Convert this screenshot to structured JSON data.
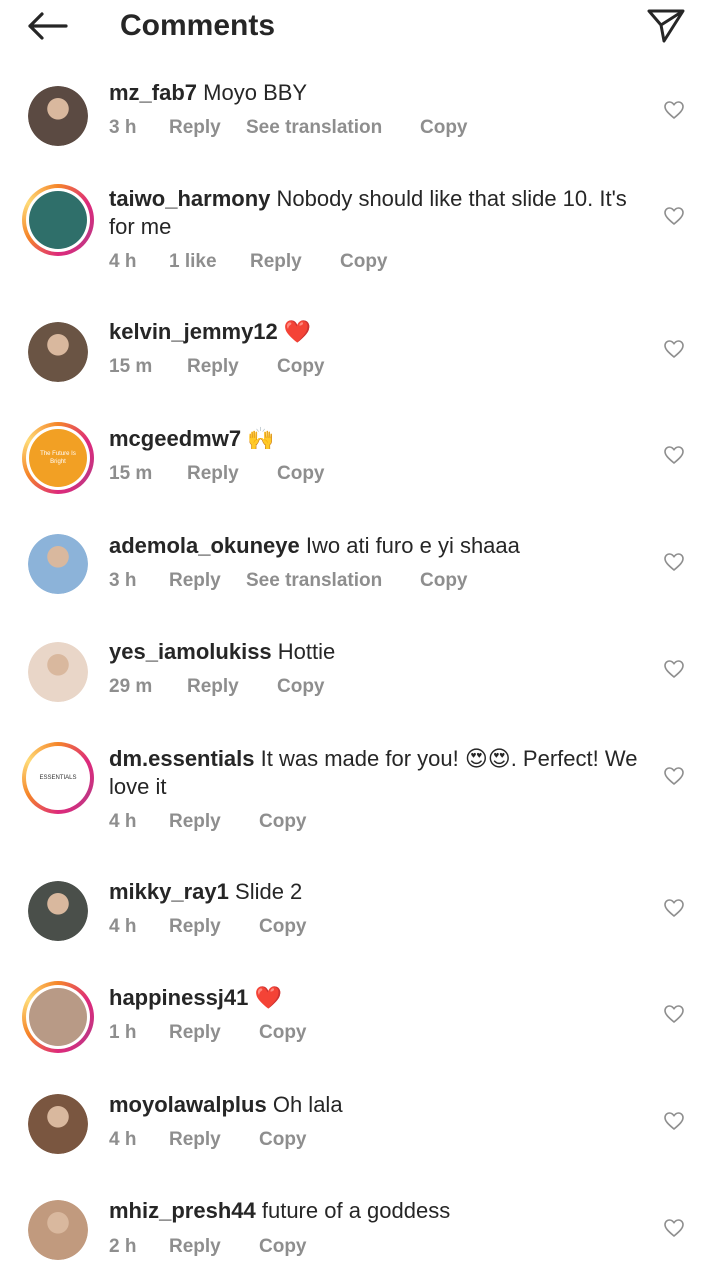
{
  "header": {
    "title": "Comments",
    "back_icon": "arrow-left-icon",
    "send_icon": "paper-plane-icon"
  },
  "comments": [
    {
      "username": "mz_fab7",
      "text": "Moyo BBY",
      "time": "3 h",
      "likes": "",
      "reply": "Reply",
      "translate": "See translation",
      "copy": "Copy",
      "avatar_color": "#5b4a42",
      "ring": false
    },
    {
      "username": "taiwo_harmony",
      "text": "Nobody should like that slide 10. It's for me",
      "time": "4 h",
      "likes": "1 like",
      "reply": "Reply",
      "translate": "",
      "copy": "Copy",
      "avatar_color": "#2f6f6a",
      "ring": true
    },
    {
      "username": "kelvin_jemmy12",
      "text": "❤️",
      "time": "15 m",
      "likes": "",
      "reply": "Reply",
      "translate": "",
      "copy": "Copy",
      "avatar_color": "#6a5444",
      "ring": false
    },
    {
      "username": "mcgeedmw7",
      "text": "🙌",
      "time": "15 m",
      "likes": "",
      "reply": "Reply",
      "translate": "",
      "copy": "Copy",
      "avatar_color": "#f2a024",
      "ring": true,
      "avatar_text": "The Future Is Bright"
    },
    {
      "username": "ademola_okuneye",
      "text": "Iwo ati furo e yi shaaa",
      "time": "3 h",
      "likes": "",
      "reply": "Reply",
      "translate": "See translation",
      "copy": "Copy",
      "avatar_color": "#8cb3d9",
      "ring": false
    },
    {
      "username": "yes_iamolukiss",
      "text": "Hottie",
      "time": "29 m",
      "likes": "",
      "reply": "Reply",
      "translate": "",
      "copy": "Copy",
      "avatar_color": "#e9d6c8",
      "ring": false
    },
    {
      "username": "dm.essentials",
      "text": "It was made for you! 😍😍. Perfect! We love it",
      "time": "4 h",
      "likes": "",
      "reply": "Reply",
      "translate": "",
      "copy": "Copy",
      "avatar_color": "#ffffff",
      "ring": true,
      "avatar_text": "ESSENTIALS"
    },
    {
      "username": "mikky_ray1",
      "text": "Slide 2",
      "time": "4 h",
      "likes": "",
      "reply": "Reply",
      "translate": "",
      "copy": "Copy",
      "avatar_color": "#4a4f4a",
      "ring": false
    },
    {
      "username": "happinessj41",
      "text": "❤️",
      "time": "1 h",
      "likes": "",
      "reply": "Reply",
      "translate": "",
      "copy": "Copy",
      "avatar_color": "#b89a86",
      "ring": true
    },
    {
      "username": "moyolawalplus",
      "text": "Oh lala",
      "time": "4 h",
      "likes": "",
      "reply": "Reply",
      "translate": "",
      "copy": "Copy",
      "avatar_color": "#7a5640",
      "ring": false
    },
    {
      "username": "mhiz_presh44",
      "text": "future of a goddess",
      "time": "2 h",
      "likes": "",
      "reply": "Reply",
      "translate": "",
      "copy": "Copy",
      "avatar_color": "#c19a7e",
      "ring": false
    }
  ]
}
